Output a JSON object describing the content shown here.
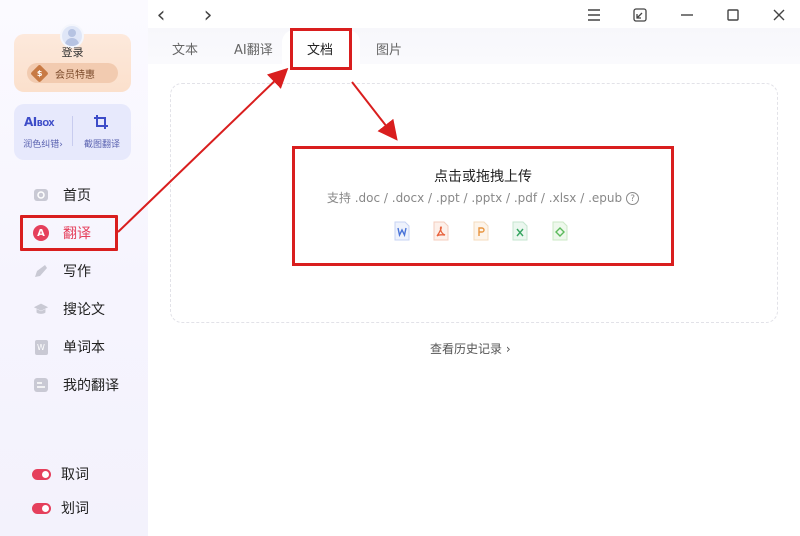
{
  "sidebar": {
    "login_label": "登录",
    "vip_label": "会员特惠",
    "vip_icon": "$",
    "tools": [
      {
        "label": "润色纠错",
        "icon": "aibox-icon",
        "icon_text": "AI",
        "icon_small": "BOX",
        "chevron": "›"
      },
      {
        "label": "截图翻译",
        "icon": "crop-icon"
      }
    ],
    "nav": [
      {
        "label": "首页",
        "icon": "home-icon"
      },
      {
        "label": "翻译",
        "icon": "translate-icon",
        "icon_text": "A",
        "active": true
      },
      {
        "label": "写作",
        "icon": "pen-icon"
      },
      {
        "label": "搜论文",
        "icon": "graduation-cap-icon"
      },
      {
        "label": "单词本",
        "icon": "wordbook-icon",
        "icon_text": "W"
      },
      {
        "label": "我的翻译",
        "icon": "my-translation-icon"
      }
    ],
    "toggles": [
      {
        "label": "取词",
        "on": true
      },
      {
        "label": "划词",
        "on": true
      }
    ]
  },
  "titlebar": {
    "back": "‹",
    "forward": "›"
  },
  "tabs": [
    {
      "label": "文本"
    },
    {
      "label": "AI翻译"
    },
    {
      "label": "文档",
      "active": true
    },
    {
      "label": "图片"
    }
  ],
  "upload": {
    "title": "点击或拖拽上传",
    "formats": "支持 .doc / .docx / .ppt / .pptx / .pdf / .xlsx / .epub",
    "help": "?",
    "file_types": [
      {
        "icon": "word-icon",
        "color": "#4a74d8"
      },
      {
        "icon": "pdf-icon",
        "color": "#e8623c"
      },
      {
        "icon": "ppt-icon",
        "color": "#e89540"
      },
      {
        "icon": "excel-icon",
        "color": "#36a561"
      },
      {
        "icon": "epub-icon",
        "color": "#5cba5c"
      }
    ]
  },
  "history_link": "查看历史记录 ›",
  "colors": {
    "accent": "#e5405c",
    "annotation_red": "#d91e1e"
  }
}
